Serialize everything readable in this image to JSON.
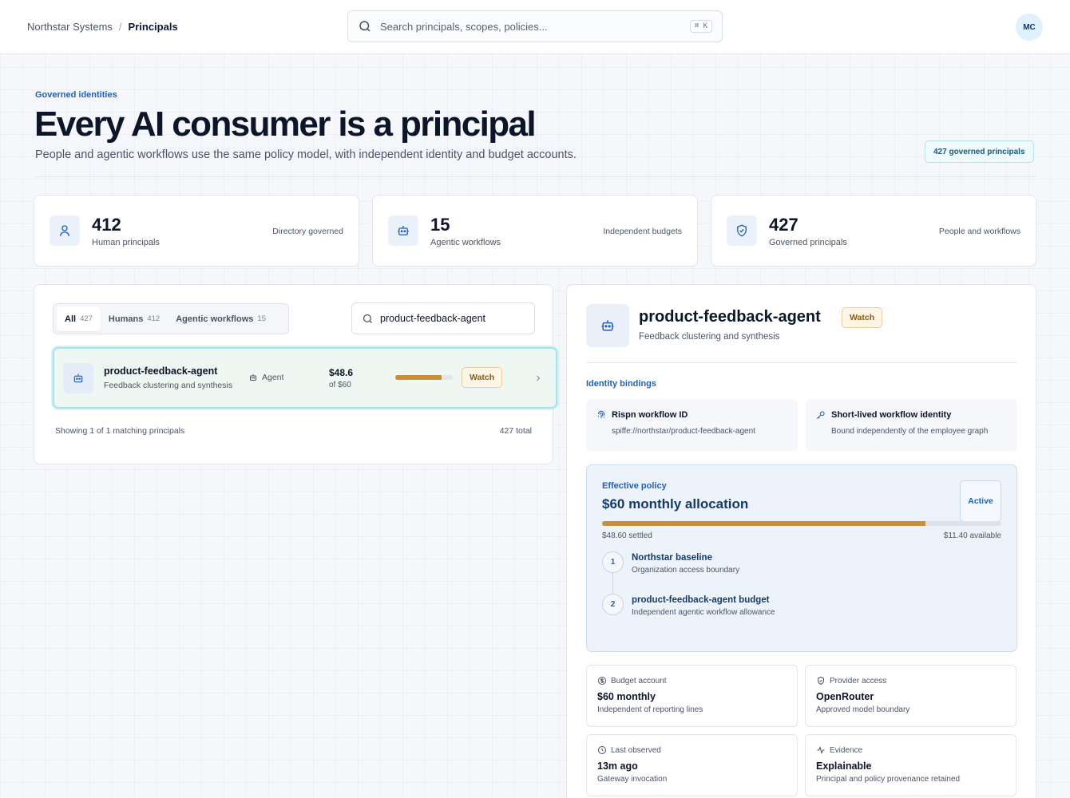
{
  "breadcrumb": {
    "org": "Northstar Systems",
    "separator": "/",
    "current": "Principals"
  },
  "search": {
    "placeholder": "Search principals, scopes, policies...",
    "shortcut": "⌘ K"
  },
  "user": {
    "initials": "MC"
  },
  "hero": {
    "eyebrow": "Governed identities",
    "title": "Every AI consumer is a principal",
    "subtitle": "People and agentic workflows use the same policy model, with independent identity and budget accounts.",
    "badge": "427 governed principals"
  },
  "stats": [
    {
      "value": "412",
      "label": "Human principals",
      "note": "Directory governed",
      "icon": "user-icon"
    },
    {
      "value": "15",
      "label": "Agentic workflows",
      "note": "Independent budgets",
      "icon": "bot-icon"
    },
    {
      "value": "427",
      "label": "Governed principals",
      "note": "People and workflows",
      "icon": "shield-check-icon"
    }
  ],
  "filters": {
    "tabs": [
      {
        "label": "All",
        "count": "427",
        "active": true
      },
      {
        "label": "Humans",
        "count": "412",
        "active": false
      },
      {
        "label": "Agentic workflows",
        "count": "15",
        "active": false
      }
    ],
    "query": "product-feedback-agent"
  },
  "list": {
    "rows": [
      {
        "name": "product-feedback-agent",
        "description": "Feedback clustering and synthesis",
        "kind": "Agent",
        "spent": "$48.6",
        "limit": "of $60",
        "usage_fraction": 0.81,
        "status": "Watch"
      }
    ],
    "footer_left": "Showing 1 of 1 matching principals",
    "footer_right": "427 total"
  },
  "detail": {
    "name": "product-feedback-agent",
    "status": "Watch",
    "description": "Feedback clustering and synthesis",
    "bindings_title": "Identity bindings",
    "bindings": [
      {
        "title": "Rispn workflow ID",
        "value": "spiffe://northstar/product-feedback-agent",
        "icon": "fingerprint-icon"
      },
      {
        "title": "Short-lived workflow identity",
        "value": "Bound independently of the employee graph",
        "icon": "key-icon"
      }
    ],
    "policy": {
      "eyebrow": "Effective policy",
      "title": "$60 monthly allocation",
      "status": "Active",
      "usage_fraction": 0.81,
      "settled": "$48.60 settled",
      "available": "$11.40 available",
      "steps": [
        {
          "num": "1",
          "title": "Northstar baseline",
          "subtitle": "Organization access boundary"
        },
        {
          "num": "2",
          "title": "product-feedback-agent budget",
          "subtitle": "Independent agentic workflow allowance"
        }
      ]
    },
    "facts": [
      {
        "label": "Budget account",
        "value": "$60 monthly",
        "sub": "Independent of reporting lines",
        "icon": "dollar-icon"
      },
      {
        "label": "Provider access",
        "value": "OpenRouter",
        "sub": "Approved model boundary",
        "icon": "shield-check-icon"
      },
      {
        "label": "Last observed",
        "value": "13m ago",
        "sub": "Gateway invocation",
        "icon": "clock-icon"
      },
      {
        "label": "Evidence",
        "value": "Explainable",
        "sub": "Principal and policy provenance retained",
        "icon": "activity-icon"
      }
    ]
  },
  "colors": {
    "accent": "#2460b3",
    "warning": "#c98f3a",
    "selected_row": "#eef7f1"
  }
}
